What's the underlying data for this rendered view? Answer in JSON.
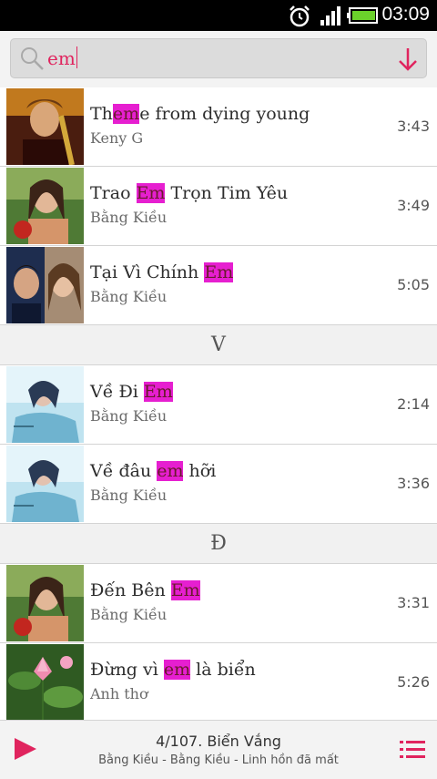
{
  "status_bar": {
    "time": "03:09",
    "icons": [
      "alarm-icon",
      "signal-icon",
      "battery-icon"
    ]
  },
  "search": {
    "query": "em",
    "icons": [
      "search-icon",
      "sort-down-arrow-icon"
    ]
  },
  "songs": [
    {
      "pre": "Th",
      "hl": "em",
      "post": "e from dying young",
      "artist": "Keny G",
      "duration": "3:43"
    },
    {
      "pre": "Trao ",
      "hl": "Em",
      "post": " Trọn Tim Yêu",
      "artist": "Bằng Kiều",
      "duration": "3:49"
    },
    {
      "pre": "Tại Vì Chính ",
      "hl": "Em",
      "post": "",
      "artist": "Bằng Kiều",
      "duration": "5:05"
    },
    {
      "section": "V"
    },
    {
      "pre": "Về Đi ",
      "hl": "Em",
      "post": "",
      "artist": "Bằng Kiều",
      "duration": "2:14"
    },
    {
      "pre": "Về đâu ",
      "hl": "em",
      "post": " hỡi",
      "artist": "Bằng Kiều",
      "duration": "3:36"
    },
    {
      "section": "Đ"
    },
    {
      "pre": "Đến Bên ",
      "hl": "Em",
      "post": "",
      "artist": "Bằng Kiều",
      "duration": "3:31"
    },
    {
      "pre": "Đừng vì ",
      "hl": "em",
      "post": " là biển",
      "artist": "Anh thơ",
      "duration": "5:26"
    }
  ],
  "colors": {
    "accent": "#e0245e",
    "highlight": "#e61fd0"
  },
  "player": {
    "now_playing": "4/107. Biển Vắng",
    "subtitle": "Bằng Kiều - Bằng Kiều - Linh hồn đã mất",
    "icons": [
      "play-icon",
      "playlist-icon"
    ]
  }
}
